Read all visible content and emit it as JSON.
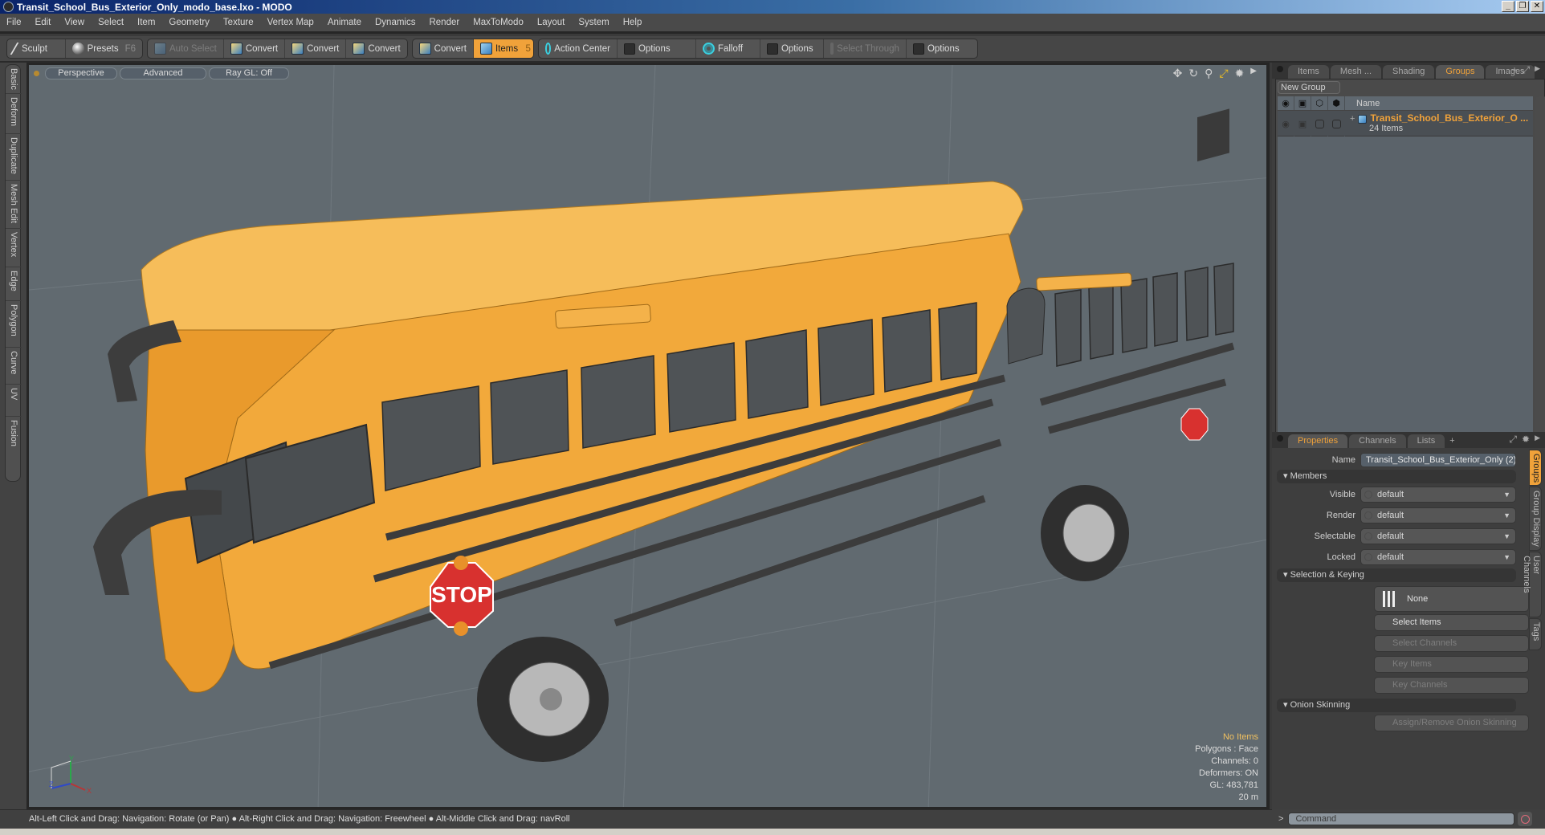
{
  "window": {
    "title": "Transit_School_Bus_Exterior_Only_modo_base.lxo - MODO",
    "buttons": [
      "_",
      "❐",
      "✕"
    ]
  },
  "menu": [
    "File",
    "Edit",
    "View",
    "Select",
    "Item",
    "Geometry",
    "Texture",
    "Vertex Map",
    "Animate",
    "Dynamics",
    "Render",
    "MaxToModo",
    "Layout",
    "System",
    "Help"
  ],
  "toolbar": {
    "sculpt": "Sculpt",
    "presets": "Presets",
    "presets_hotkey": "F6",
    "auto_select": "Auto Select",
    "convert1": "Convert",
    "convert2": "Convert",
    "convert3": "Convert",
    "convert4": "Convert",
    "items": "Items",
    "items_hotkey": "5",
    "action_center": "Action Center",
    "options1": "Options",
    "falloff": "Falloff",
    "options2": "Options",
    "select_through": "Select Through",
    "options3": "Options"
  },
  "left_tabs": [
    "Basic",
    "Deform",
    "Duplicate",
    "Mesh Edit",
    "Vertex",
    "Edge",
    "Polygon",
    "Curve",
    "UV",
    "Fusion"
  ],
  "viewport": {
    "view_mode": "Perspective",
    "shading": "Advanced",
    "raygl": "Ray GL: Off",
    "icons": [
      "move-view-icon",
      "rotate-view-icon",
      "zoom-view-icon",
      "fit-view-icon",
      "settings-icon",
      "expand-arrow-icon"
    ],
    "info": {
      "selection": "No Items",
      "polygons": "Polygons : Face",
      "channels": "Channels: 0",
      "deformers": "Deformers: ON",
      "gl": "GL: 483,781",
      "scale": "20 m"
    },
    "axes": {
      "x": "X",
      "y": "Y",
      "z": "Z"
    },
    "colors": {
      "bus_body": "#f2a93b",
      "bus_roof": "#f6bd5a",
      "stripe": "#3c3c3c",
      "stop_sign": "#d8312f",
      "background": "#616a70"
    },
    "stop_sign_text": "STOP"
  },
  "groups_panel": {
    "tabs": [
      "Items",
      "Mesh ...",
      "Shading",
      "Groups",
      "Images"
    ],
    "active_tab": "Groups",
    "new_group": "New Group",
    "columns": {
      "name": "Name"
    },
    "rows": [
      {
        "name": "Transit_School_Bus_Exterior_O ...",
        "count": "24 Items"
      }
    ]
  },
  "properties_panel": {
    "tabs": [
      "Properties",
      "Channels",
      "Lists"
    ],
    "active_tab": "Properties",
    "name_label": "Name",
    "name_value": "Transit_School_Bus_Exterior_Only (2)",
    "members_section": "Members",
    "visible_label": "Visible",
    "visible_value": "default",
    "render_label": "Render",
    "render_value": "default",
    "selectable_label": "Selectable",
    "selectable_value": "default",
    "locked_label": "Locked",
    "locked_value": "default",
    "selkey_section": "Selection & Keying",
    "selection_mode": "None",
    "select_items": "Select Items",
    "select_channels": "Select Channels",
    "key_items": "Key Items",
    "key_channels": "Key Channels",
    "onion_section": "Onion Skinning",
    "assign_onion": "Assign/Remove Onion Skinning",
    "side_tabs": [
      "Groups",
      "Group Display",
      "User Channels",
      "Tags"
    ],
    "active_side_tab": "Groups"
  },
  "statusbar": {
    "hint1": "Alt-Left Click and Drag: Navigation: Rotate (or Pan)",
    "hint2": "Alt-Right Click and Drag: Navigation: Freewheel",
    "hint3": "Alt-Middle Click and Drag: navRoll",
    "sep": "●"
  },
  "command": {
    "prompt": ">",
    "placeholder": "Command"
  }
}
